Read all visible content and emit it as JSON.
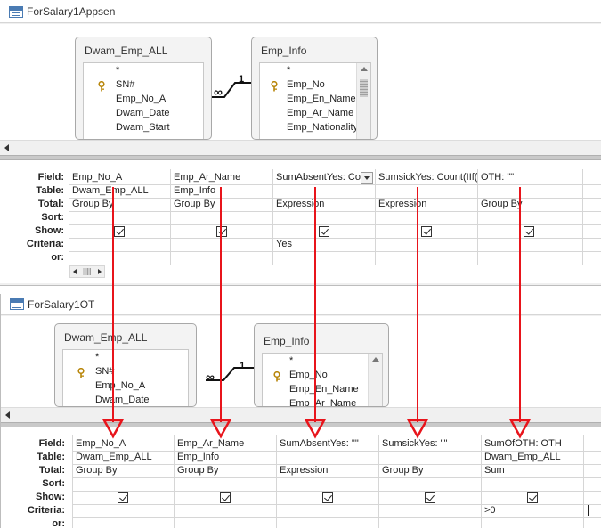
{
  "windows": [
    {
      "title": "ForSalary1Appsen",
      "tables": [
        {
          "name": "Dwam_Emp_ALL",
          "fields": [
            "*",
            "SN#",
            "Emp_No_A",
            "Dwam_Date",
            "Dwam_Start"
          ],
          "key_field_index": 1
        },
        {
          "name": "Emp_Info",
          "fields": [
            "*",
            "Emp_No",
            "Emp_En_Name",
            "Emp_Ar_Name",
            "Emp_Nationality"
          ],
          "key_field_index": 1
        }
      ],
      "join": {
        "many": "∞",
        "one": "1"
      },
      "grid": {
        "row_labels": [
          "Field:",
          "Table:",
          "Total:",
          "Sort:",
          "Show:",
          "Criteria:",
          "or:"
        ],
        "columns": [
          {
            "field": "Emp_No_A",
            "table": "Dwam_Emp_ALL",
            "total": "Group By",
            "sort": "",
            "show": true,
            "criteria": "",
            "or": ""
          },
          {
            "field": "Emp_Ar_Name",
            "table": "Emp_Info",
            "total": "Group By",
            "sort": "",
            "show": true,
            "criteria": "",
            "or": ""
          },
          {
            "field": "SumAbsentYes: Co",
            "table": "",
            "total": "Expression",
            "sort": "",
            "show": true,
            "criteria": "Yes",
            "or": ""
          },
          {
            "field": "SumsickYes: Count(IIf(",
            "table": "",
            "total": "Expression",
            "sort": "",
            "show": true,
            "criteria": "",
            "or": ""
          },
          {
            "field": "OTH: \"\"",
            "table": "",
            "total": "Group By",
            "sort": "",
            "show": true,
            "criteria": "",
            "or": ""
          }
        ]
      }
    },
    {
      "title": "ForSalary1OT",
      "tables": [
        {
          "name": "Dwam_Emp_ALL",
          "fields": [
            "*",
            "SN#",
            "Emp_No_A",
            "Dwam_Date"
          ],
          "key_field_index": 1
        },
        {
          "name": "Emp_Info",
          "fields": [
            "*",
            "Emp_No",
            "Emp_En_Name",
            "Emp_Ar_Name"
          ],
          "key_field_index": 1
        }
      ],
      "join": {
        "many": "∞",
        "one": "1"
      },
      "grid": {
        "row_labels": [
          "Field:",
          "Table:",
          "Total:",
          "Sort:",
          "Show:",
          "Criteria:",
          "or:"
        ],
        "columns": [
          {
            "field": "Emp_No_A",
            "table": "Dwam_Emp_ALL",
            "total": "Group By",
            "sort": "",
            "show": true,
            "criteria": "",
            "or": ""
          },
          {
            "field": "Emp_Ar_Name",
            "table": "Emp_Info",
            "total": "Group By",
            "sort": "",
            "show": true,
            "criteria": "",
            "or": ""
          },
          {
            "field": "SumAbsentYes: \"\"",
            "table": "",
            "total": "Expression",
            "sort": "",
            "show": true,
            "criteria": "",
            "or": ""
          },
          {
            "field": "SumsickYes: \"\"",
            "table": "",
            "total": "Group By",
            "sort": "",
            "show": true,
            "criteria": "",
            "or": ""
          },
          {
            "field": "SumOfOTH: OTH",
            "table": "Dwam_Emp_ALL",
            "total": "Sum",
            "sort": "",
            "show": true,
            "criteria": ">0",
            "or": ""
          }
        ]
      }
    }
  ],
  "colors": {
    "annotation_arrow": "#e8141b",
    "window_bg": "#f0f0f0",
    "grid_line": "#d6d6d6"
  }
}
